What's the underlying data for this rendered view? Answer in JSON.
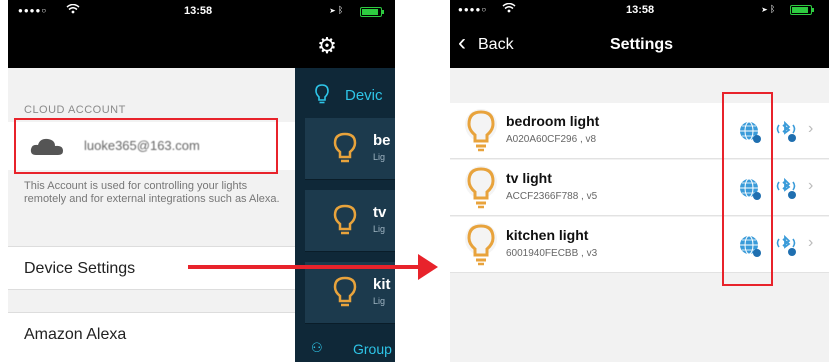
{
  "left_phone": {
    "status": {
      "signal": "●●●●○",
      "time": "13:58"
    },
    "cloud_account": {
      "label": "CLOUD ACCOUNT",
      "email": "luoke365@163.com",
      "note": "This Account is used for controlling your lights remotely and for external integrations such as Alexa."
    },
    "device_settings_label": "Device Settings",
    "amazon_alexa_label": "Amazon Alexa",
    "drawer": {
      "devices_label": "Devic",
      "items": [
        {
          "name": "be",
          "sub": "Lig"
        },
        {
          "name": "tv",
          "sub": "Lig"
        },
        {
          "name": "kit",
          "sub": "Lig"
        }
      ],
      "groups_label": "Group"
    }
  },
  "right_phone": {
    "status": {
      "signal": "●●●●○",
      "time": "13:58"
    },
    "nav": {
      "back_label": "Back",
      "title": "Settings"
    },
    "lights": [
      {
        "name": "bedroom light",
        "sub": "A020A60CF296 , v8"
      },
      {
        "name": "tv light",
        "sub": "ACCF2366F788 , v5"
      },
      {
        "name": "kitchen light",
        "sub": "6001940FECBB , v3"
      }
    ]
  },
  "colors": {
    "highlight_red": "#e8232b",
    "drawer_bg": "#0f2838",
    "accent_cyan": "#2ec5e8",
    "bulb_orange": "#e8a33c"
  },
  "icons": [
    "gear-icon",
    "cloud-icon",
    "bulb-icon",
    "globe-icon",
    "bluetooth-icon",
    "chevron-right-icon",
    "back-chevron-icon",
    "groups-icon"
  ]
}
